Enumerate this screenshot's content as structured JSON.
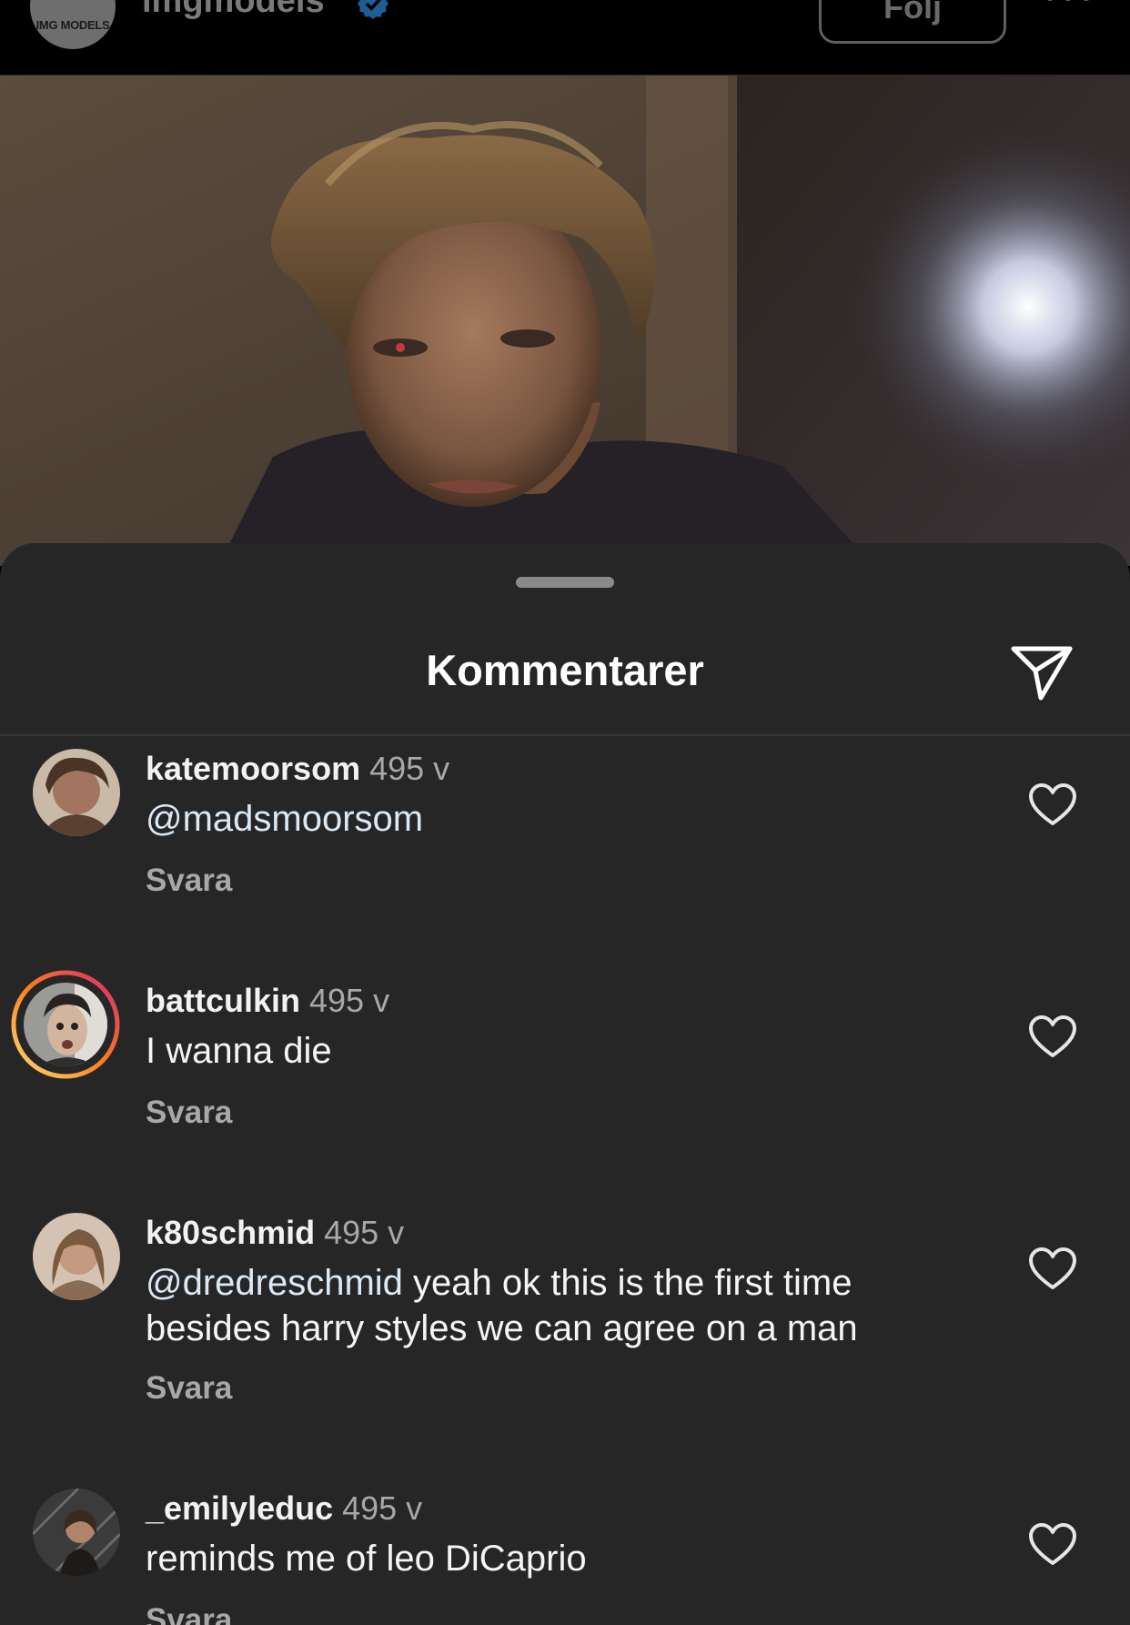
{
  "post_header": {
    "avatar_text": "IMG MODELS",
    "username": "imgmodels",
    "verified_icon": "verified-badge-icon",
    "follow_label": "Följ",
    "more_icon": "more-horizontal-icon"
  },
  "photo": {
    "description_icon": "post-photo"
  },
  "sheet": {
    "title": "Kommentarer",
    "share_icon": "paper-plane-icon"
  },
  "comments": [
    {
      "username": "katemoorsom",
      "time": "495 v",
      "mention": "@madsmoorsom",
      "text": "",
      "reply_label": "Svara",
      "like_icon": "heart-icon"
    },
    {
      "username": "battculkin",
      "time": "495 v",
      "mention": "",
      "text": "I wanna die",
      "reply_label": "Svara",
      "like_icon": "heart-icon"
    },
    {
      "username": "k80schmid",
      "time": "495 v",
      "mention": "@dredreschmid",
      "text": " yeah ok this is the first time besides harry styles we can agree on a man",
      "reply_label": "Svara",
      "like_icon": "heart-icon"
    },
    {
      "username": "_emilyleduc",
      "time": "495 v",
      "mention": "",
      "text": "reminds me of leo DiCaprio",
      "reply_label": "Svara",
      "like_icon": "heart-icon"
    }
  ],
  "colors": {
    "sheet_background": "#262626",
    "story_ring_start": "#feda75",
    "story_ring_end": "#d62976",
    "verified_blue": "#0095f6"
  }
}
